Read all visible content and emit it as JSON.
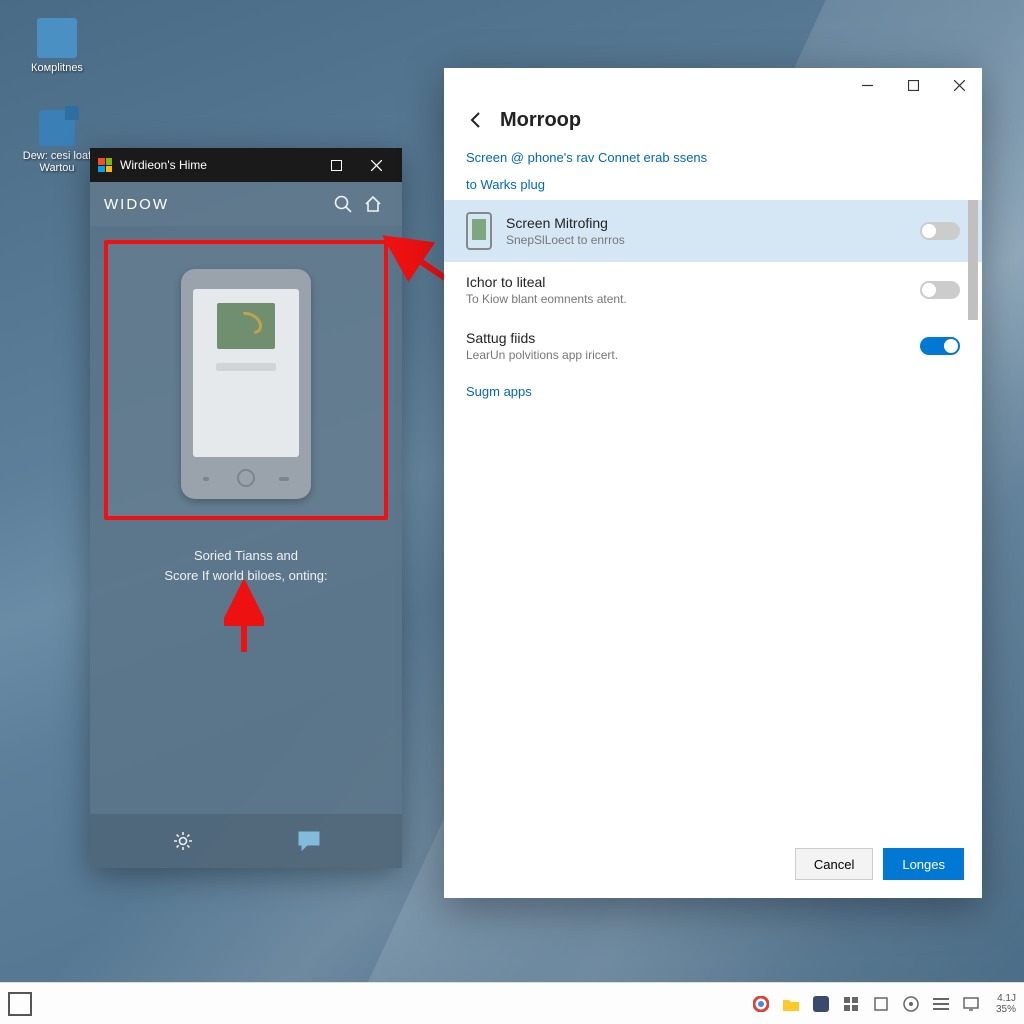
{
  "desktop_icons": [
    {
      "label": "Комplitnes"
    },
    {
      "label": "Dew: cesi loaf Wartou"
    }
  ],
  "phone_window": {
    "title": "Wirdieon's Hime",
    "header": "WIDOW",
    "subtext_line1": "Soried Tianss and",
    "subtext_line2": "Score If world biloes, onting:",
    "icons": {
      "maximize": "maximize",
      "close": "close",
      "search": "search",
      "home": "home",
      "gear": "settings",
      "chat": "chat"
    }
  },
  "settings_window": {
    "title": "Morroop",
    "subtitle": "Screen @ phone's rav Connet erab ssens",
    "section": "to Warks plug",
    "rows": [
      {
        "title": "Screen Mitrofing",
        "sub": "SnepSlLoect to enrros",
        "on": false,
        "highlight": true,
        "icon": "phone"
      },
      {
        "title": "Ichor to liteal",
        "sub": "To Kiow blant eomnents atent.",
        "on": false,
        "highlight": false,
        "icon": ""
      },
      {
        "title": "Sattug fiids",
        "sub": "LearUn polvitions app iricert.",
        "on": true,
        "highlight": false,
        "icon": ""
      }
    ],
    "link": "Sugm apps",
    "buttons": {
      "cancel": "Cancel",
      "ok": "Longes"
    },
    "win_controls": {
      "min": "minimize",
      "max": "maximize",
      "close": "close"
    }
  },
  "taskbar": {
    "tray_icons": [
      "chrome",
      "folder",
      "app",
      "grid",
      "square",
      "info",
      "list",
      "monitor"
    ],
    "clock_time": "4.1J",
    "clock_pct": "35%"
  }
}
